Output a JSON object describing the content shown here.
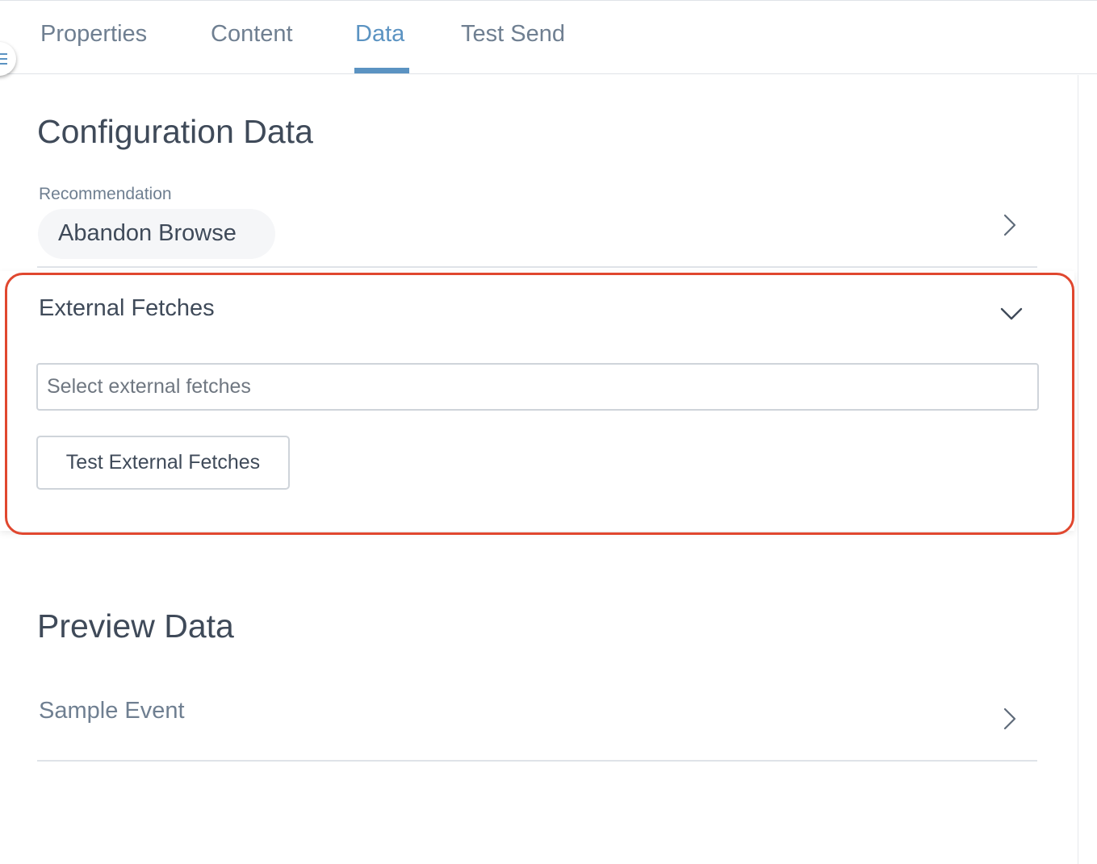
{
  "tabs": [
    {
      "label": "Properties",
      "active": false
    },
    {
      "label": "Content",
      "active": false
    },
    {
      "label": "Data",
      "active": true
    },
    {
      "label": "Test Send",
      "active": false
    }
  ],
  "configuration": {
    "title": "Configuration Data",
    "recommendation_label": "Recommendation",
    "recommendation_value": "Abandon Browse"
  },
  "external_fetches": {
    "title": "External Fetches",
    "expanded": true,
    "input_value": "",
    "input_placeholder": "Select external fetches",
    "test_button_label": "Test External Fetches"
  },
  "preview": {
    "title": "Preview Data",
    "sample_event_label": "Sample Event"
  },
  "icons": {
    "menu": "menu-icon",
    "recommendation_chevron": "chevron-right-icon",
    "external_fetches_toggle": "chevron-down-icon",
    "sample_event_chevron": "chevron-right-icon"
  },
  "colors": {
    "accent": "#5b93c2",
    "highlight": "#e0472f",
    "text_primary": "#3f4a59",
    "text_secondary": "#6f7f91"
  }
}
